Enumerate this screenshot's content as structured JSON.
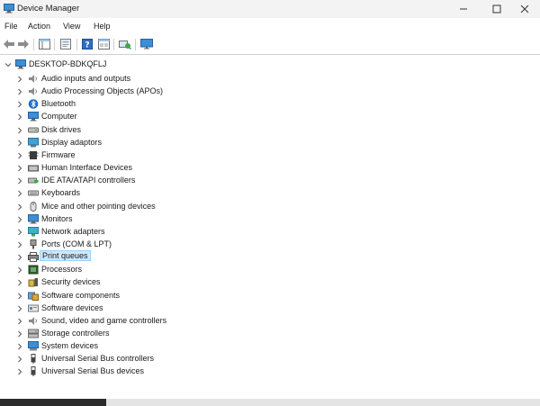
{
  "window": {
    "title": "Device Manager"
  },
  "menu": [
    "File",
    "Action",
    "View",
    "Help"
  ],
  "toolbar": {
    "icons": [
      "back-arrow-icon",
      "forward-arrow-icon",
      "properties-icon",
      "update-driver-icon",
      "help-icon",
      "properties-sheet-icon",
      "scan-hardware-icon",
      "monitor-icon"
    ]
  },
  "tree": {
    "root": "DESKTOP-BDKQFLJ",
    "items": [
      {
        "label": "Audio inputs and outputs",
        "icon": "speaker-icon"
      },
      {
        "label": "Audio Processing Objects (APOs)",
        "icon": "speaker-icon"
      },
      {
        "label": "Bluetooth",
        "icon": "bluetooth-icon"
      },
      {
        "label": "Computer",
        "icon": "computer-icon"
      },
      {
        "label": "Disk drives",
        "icon": "disk-icon"
      },
      {
        "label": "Display adaptors",
        "icon": "display-icon"
      },
      {
        "label": "Firmware",
        "icon": "firmware-icon"
      },
      {
        "label": "Human Interface Devices",
        "icon": "hid-icon"
      },
      {
        "label": "IDE ATA/ATAPI controllers",
        "icon": "ide-icon"
      },
      {
        "label": "Keyboards",
        "icon": "keyboard-icon"
      },
      {
        "label": "Mice and other pointing devices",
        "icon": "mouse-icon"
      },
      {
        "label": "Monitors",
        "icon": "monitor-icon"
      },
      {
        "label": "Network adapters",
        "icon": "network-icon"
      },
      {
        "label": "Ports (COM & LPT)",
        "icon": "port-icon"
      },
      {
        "label": "Print queues",
        "icon": "printer-icon",
        "selected": true
      },
      {
        "label": "Processors",
        "icon": "processor-icon"
      },
      {
        "label": "Security devices",
        "icon": "security-icon"
      },
      {
        "label": "Software components",
        "icon": "software-component-icon"
      },
      {
        "label": "Software devices",
        "icon": "software-device-icon"
      },
      {
        "label": "Sound, video and game controllers",
        "icon": "speaker-icon"
      },
      {
        "label": "Storage controllers",
        "icon": "storage-icon"
      },
      {
        "label": "System devices",
        "icon": "system-icon"
      },
      {
        "label": "Universal Serial Bus controllers",
        "icon": "usb-icon"
      },
      {
        "label": "Universal Serial Bus devices",
        "icon": "usb-icon"
      }
    ]
  },
  "colors": {
    "selection_bg": "#cce8ff",
    "selection_border": "#99d1ff",
    "titlebar": "#f3f3f3"
  }
}
